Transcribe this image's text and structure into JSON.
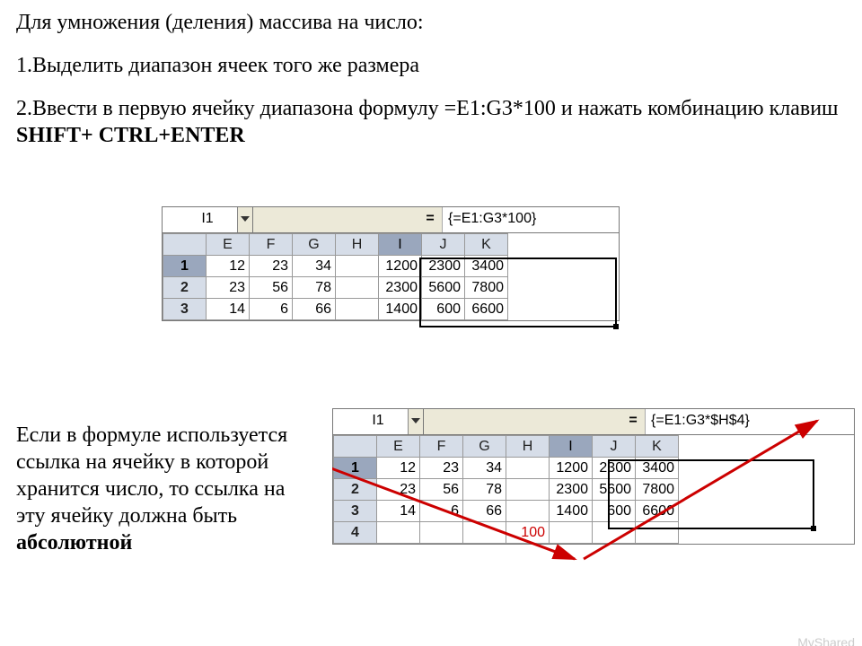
{
  "para_title": "Для умножения (деления) массива на число:",
  "para_1": "1.Выделить диапазон ячеек того же  размера",
  "para_2a": "2.Ввести в первую ячейку диапазона формулу =E1:G3*100 и нажать комбинацию клавиш ",
  "para_2b": "SHIFT+ CTRL+ENTER",
  "note_a": "Если в формуле используется ссылка на ячейку в которой хранится число, то ссылка на эту ячейку должна быть ",
  "note_b": "абсолютной",
  "watermark": "MyShared",
  "sheet1": {
    "namebox": "I1",
    "eq": "=",
    "formula": "{=E1:G3*100}",
    "cols": [
      "E",
      "F",
      "G",
      "H",
      "I",
      "J",
      "K"
    ],
    "rows": [
      {
        "h": "1",
        "c": [
          "12",
          "23",
          "34",
          "",
          "1200",
          "2300",
          "3400"
        ]
      },
      {
        "h": "2",
        "c": [
          "23",
          "56",
          "78",
          "",
          "2300",
          "5600",
          "7800"
        ]
      },
      {
        "h": "3",
        "c": [
          "14",
          "6",
          "66",
          "",
          "1400",
          "600",
          "6600"
        ]
      }
    ]
  },
  "sheet2": {
    "namebox": "I1",
    "eq": "=",
    "formula": "{=E1:G3*$H$4}",
    "cols": [
      "E",
      "F",
      "G",
      "H",
      "I",
      "J",
      "K"
    ],
    "rows": [
      {
        "h": "1",
        "c": [
          "12",
          "23",
          "34",
          "",
          "1200",
          "2300",
          "3400"
        ]
      },
      {
        "h": "2",
        "c": [
          "23",
          "56",
          "78",
          "",
          "2300",
          "5600",
          "7800"
        ]
      },
      {
        "h": "3",
        "c": [
          "14",
          "6",
          "66",
          "",
          "1400",
          "600",
          "6600"
        ]
      },
      {
        "h": "4",
        "c": [
          "",
          "",
          "",
          "100",
          "",
          "",
          ""
        ],
        "red": 3
      }
    ]
  }
}
